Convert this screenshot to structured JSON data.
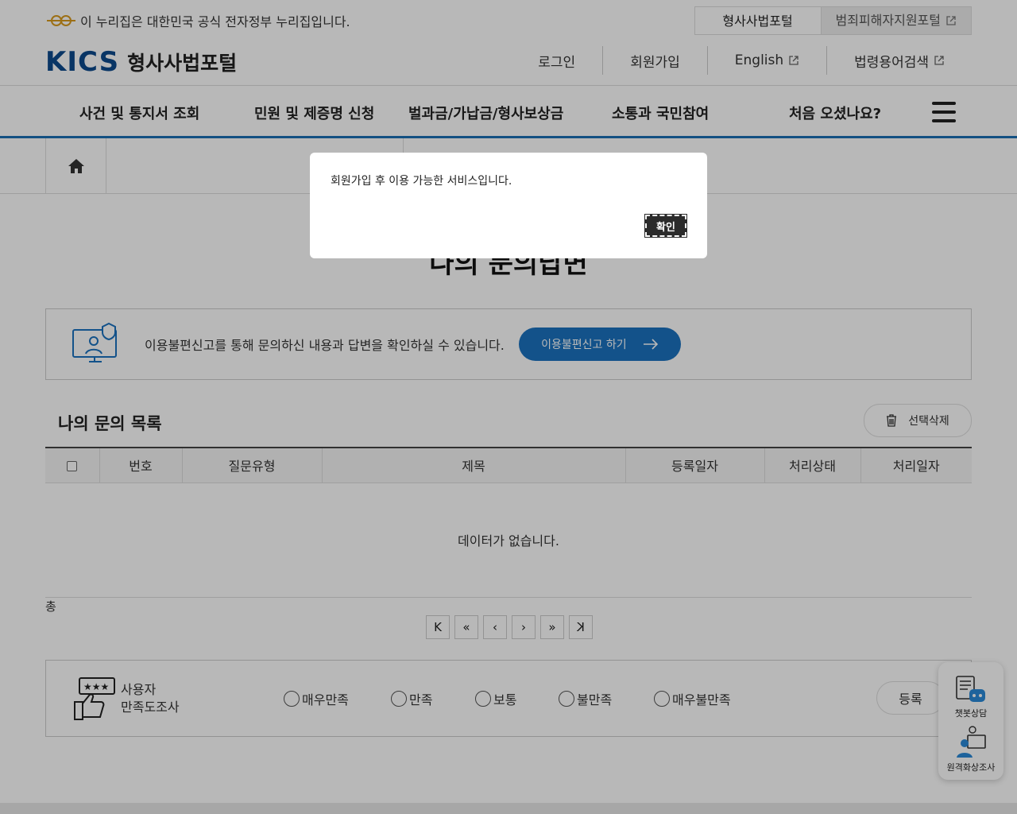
{
  "gov_banner": "이 누리집은 대한민국 공식 전자정부 누리집입니다.",
  "portal_tabs": [
    "형사사법포털",
    "범죄피해자지원포털"
  ],
  "brand": {
    "logo_text": "KICS",
    "title": "형사사법포털"
  },
  "util_menu": [
    "로그인",
    "회원가입",
    "English",
    "법령용어검색"
  ],
  "gnb": [
    "사건 및 통지서 조회",
    "민원 및 제증명 신청",
    "벌과금/가납금/형사보상금",
    "소통과 국민참여",
    "처음 오셨나요?"
  ],
  "page_title": "나의 문의답변",
  "notice": {
    "text": "이용불편신고를 통해 문의하신 내용과 답변을 확인하실 수 있습니다.",
    "button": "이용불편신고 하기"
  },
  "list": {
    "title": "나의 문의 목록",
    "delete_button": "선택삭제",
    "columns": [
      "번호",
      "질문유형",
      "제목",
      "등록일자",
      "처리상태",
      "처리일자"
    ],
    "empty_message": "데이터가 없습니다.",
    "total_label": "총"
  },
  "pager": [
    "K",
    "«",
    "‹",
    "›",
    "»",
    "K"
  ],
  "survey": {
    "label_line1": "사용자",
    "label_line2": "만족도조사",
    "options": [
      "매우만족",
      "만족",
      "보통",
      "불만족",
      "매우불만족"
    ],
    "submit": "등록"
  },
  "quick_menu": [
    "챗봇상담",
    "원격화상조사"
  ],
  "dialog": {
    "message": "회원가입 후 이용 가능한 서비스입니다.",
    "ok": "확인"
  },
  "colors": {
    "primary": "#1b72bf",
    "brand": "#0d4a8c",
    "gnb_border": "#1b6fb5"
  }
}
